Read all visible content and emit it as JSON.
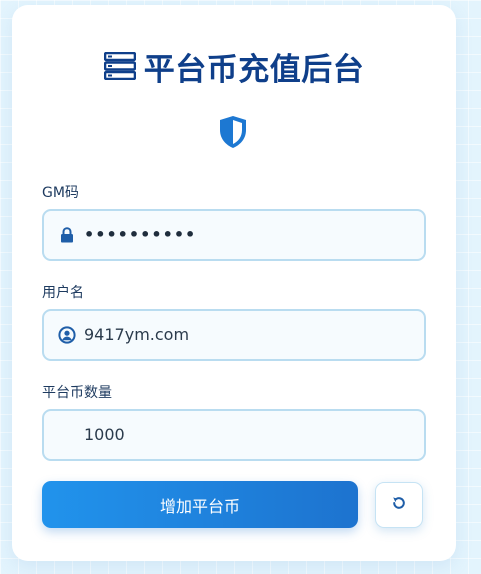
{
  "header": {
    "title": "平台币充值后台",
    "title_icon": "server-icon",
    "badge_icon": "shield-icon"
  },
  "form": {
    "gm_code": {
      "label": "GM码",
      "value": "••••••••••",
      "icon": "lock-icon"
    },
    "username": {
      "label": "用户名",
      "value": "9417ym.com",
      "icon": "user-circle-icon"
    },
    "amount": {
      "label": "平台币数量",
      "value": "1000"
    }
  },
  "actions": {
    "submit_label": "增加平台币",
    "reset_icon": "refresh-icon"
  },
  "colors": {
    "title": "#0f3f8a",
    "accent": "#1f7fd8",
    "background": "#e3f4fd"
  }
}
